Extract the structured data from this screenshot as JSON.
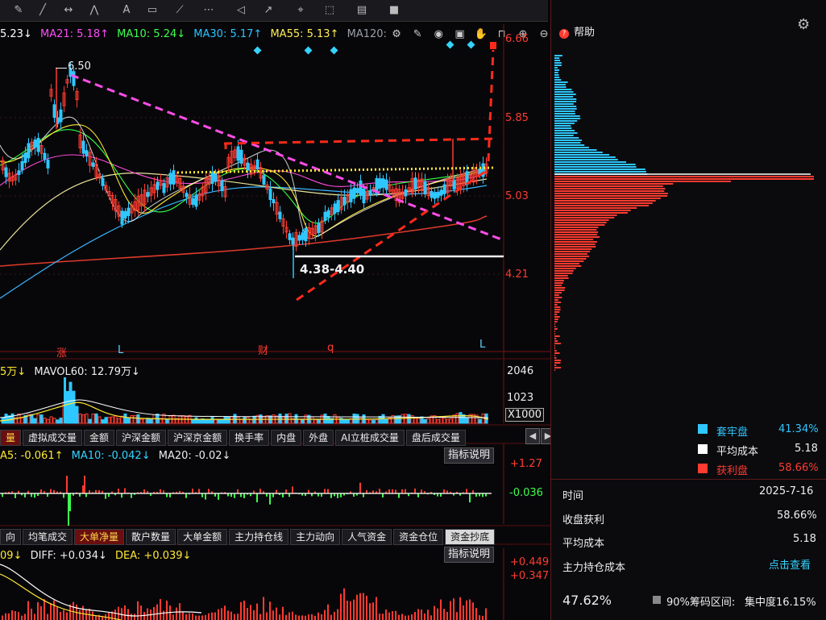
{
  "toolbar": {
    "icons": [
      "brush-icon",
      "line-icon",
      "ray-icon",
      "polyline-icon",
      "text-icon",
      "rect-icon",
      "fan-icon",
      "more-icon",
      "speaker-icon",
      "arrow-icon",
      "pin-icon",
      "select-icon",
      "chart-icon",
      "gold-icon"
    ]
  },
  "legend": {
    "items": [
      {
        "text": "5.23↓",
        "color": "#ffffff"
      },
      {
        "text": "MA21: 5.18↑",
        "color": "#ff4df5"
      },
      {
        "text": "MA10: 5.24↓",
        "color": "#3cff4c"
      },
      {
        "text": "MA30: 5.17↑",
        "color": "#28c6ff"
      },
      {
        "text": "MA55: 5.13↑",
        "color": "#ffee55"
      },
      {
        "text": "MA120: ",
        "color": "#9aa0a6"
      }
    ],
    "icon_names": [
      "settings-icon",
      "pen-icon",
      "eye-icon",
      "basket-icon",
      "hand-icon",
      "lock-icon",
      "zoom-in-icon",
      "zoom-out-icon"
    ]
  },
  "price_axis": [
    "6.66",
    "5.85",
    "5.03",
    "4.21"
  ],
  "annotations": {
    "high": "6.50",
    "range": "4.38-4.40"
  },
  "markers": [
    {
      "text": "涨",
      "color": "#ff3b30"
    },
    {
      "text": "L",
      "color": "#5fd3ff"
    },
    {
      "text": "财",
      "color": "#ff3b30"
    },
    {
      "text": "q",
      "color": "#ff3b30"
    },
    {
      "text": "L",
      "color": "#5fd3ff"
    }
  ],
  "volume": {
    "legend_a": "5万↓",
    "legend_b": "MAVOL60: 12.79万↓",
    "axis": [
      "2046",
      "1023"
    ],
    "unit": "X1000"
  },
  "tabs1": [
    "量",
    "虚拟成交量",
    "金额",
    "沪深金额",
    "沪深京金额",
    "换手率",
    "内盘",
    "外盘",
    "AI立桩成交量",
    "盘后成交量"
  ],
  "ind1": {
    "legend_a": "A5: -0.061↑",
    "legend_b": "MA10: -0.042↓",
    "legend_c": "MA20: -0.02↓",
    "note": "指标说明",
    "axis_top": "+1.27",
    "axis_mid": "-0.036"
  },
  "tabs2": [
    "向",
    "均笔成交",
    "大单净量",
    "散户数量",
    "大单金额",
    "主力持仓线",
    "主力动向",
    "人气资金",
    "资金仓位",
    "资金抄底"
  ],
  "ind2": {
    "legend_a": "09↓",
    "legend_b": "DIFF: +0.034↓",
    "legend_c": "DEA: +0.039↓",
    "note": "指标说明",
    "axis_top": "+0.449",
    "axis_b": "+0.347"
  },
  "right_panel": {
    "help": "帮助",
    "legend": [
      {
        "label": "套牢盘",
        "value": "41.34%",
        "color": "#2fc7ff"
      },
      {
        "label": "平均成本",
        "value": "5.18",
        "color": "#ffffff"
      },
      {
        "label": "获利盘",
        "value": "58.66%",
        "color": "#ff3b30"
      }
    ],
    "rows": [
      {
        "k": "时间",
        "v": "2025-7-16"
      },
      {
        "k": "收盘获利",
        "v": "58.66%"
      },
      {
        "k": "平均成本",
        "v": "5.18"
      },
      {
        "k": "主力持仓成本",
        "v": "点击查看"
      }
    ],
    "bottom": {
      "pct": "47.62%",
      "range_label": "90%筹码区间:",
      "concentration": "集中度16.15%"
    }
  },
  "colors": {
    "up": "#ff3b30",
    "down": "#2fc7ff",
    "bg": "#07070a"
  }
}
